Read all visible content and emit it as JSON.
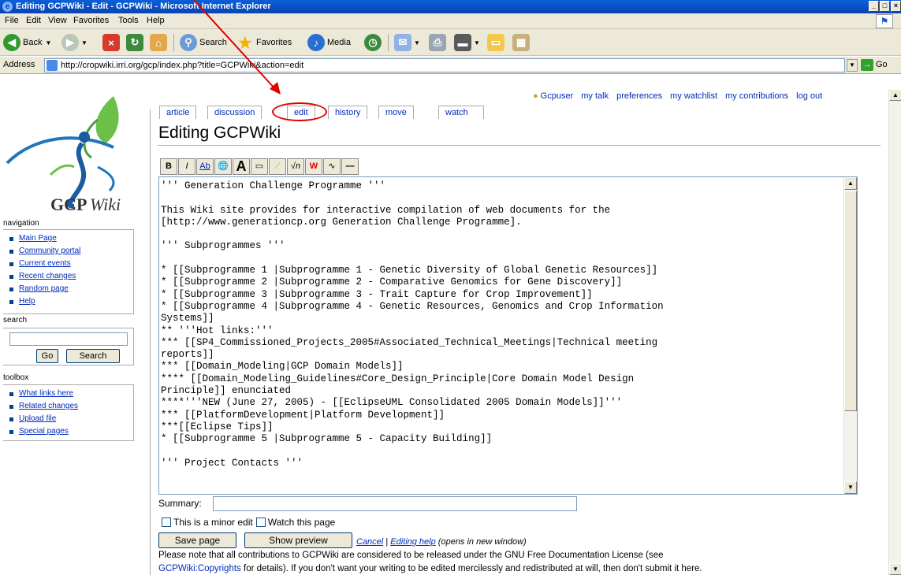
{
  "window": {
    "title": "Editing GCPWiki - Edit - GCPWiki - Microsoft Internet Explorer",
    "controls": [
      "_",
      "□",
      "×"
    ]
  },
  "menu": [
    "File",
    "Edit",
    "View",
    "Favorites",
    "Tools",
    "Help"
  ],
  "toolbar": {
    "back": "Back",
    "search": "Search",
    "favorites": "Favorites",
    "media": "Media"
  },
  "address": {
    "label": "Address",
    "url": "http://cropwiki.irri.org/gcp/index.php?title=GCPWiki&action=edit",
    "go": "Go"
  },
  "logo": {
    "text_bold": "GCP",
    "text_italic": "Wiki"
  },
  "sidebar": {
    "navigation_heading": "navigation",
    "navigation": [
      "Main Page",
      "Community portal",
      "Current events",
      "Recent changes",
      "Random page",
      "Help"
    ],
    "search_heading": "search",
    "search_value": "",
    "go_button": "Go",
    "search_button": "Search",
    "toolbox_heading": "toolbox",
    "toolbox": [
      "What links here",
      "Related changes",
      "Upload file",
      "Special pages"
    ]
  },
  "user_links": [
    "Gcpuser",
    "my talk",
    "preferences",
    "my watchlist",
    "my contributions",
    "log out"
  ],
  "tabs": [
    "article",
    "discussion",
    "edit",
    "history",
    "move",
    "watch"
  ],
  "heading": "Editing GCPWiki",
  "edit_toolbar": [
    "B",
    "I",
    "Ab",
    "🌐",
    "A",
    "▭",
    "⟋",
    "√n",
    "W",
    "∿",
    "—"
  ],
  "textarea_content": "''' Generation Challenge Programme '''\n\nThis Wiki site provides for interactive compilation of web documents for the\n[http://www.generationcp.org Generation Challenge Programme].\n\n''' Subprogrammes '''\n\n* [[Subprogramme 1 |Subprogramme 1 - Genetic Diversity of Global Genetic Resources]]\n* [[Subprogramme 2 |Subprogramme 2 - Comparative Genomics for Gene Discovery]]\n* [[Subprogramme 3 |Subprogramme 3 - Trait Capture for Crop Improvement]]\n* [[Subprogramme 4 |Subprogramme 4 - Genetic Resources, Genomics and Crop Information\nSystems]]\n** '''Hot links:'''\n*** [[SP4_Commissioned_Projects_2005#Associated_Technical_Meetings|Technical meeting\nreports]]\n*** [[Domain_Modeling|GCP Domain Models]]\n**** [[Domain_Modeling_Guidelines#Core_Design_Principle|Core Domain Model Design\nPrinciple]] enunciated\n****'''NEW (June 27, 2005) - [[EclipseUML Consolidated 2005 Domain Models]]'''\n*** [[PlatformDevelopment|Platform Development]]\n***[[Eclipse Tips]]\n* [[Subprogramme 5 |Subprogramme 5 - Capacity Building]]\n\n''' Project Contacts '''",
  "summary_label": "Summary:",
  "summary_value": "",
  "minor_edit_label": "This is a minor edit",
  "watch_label": "Watch this page",
  "save_button": "Save page",
  "preview_button": "Show preview",
  "cancel_link": "Cancel",
  "separator": "|",
  "editing_help_link": "Editing help",
  "editing_help_note": "(opens in new window)",
  "notice_line1": "Please note that all contributions to GCPWiki are considered to be released under the GNU Free Documentation License (see",
  "notice_copyright_link": "GCPWiki:Copyrights",
  "notice_line2_rest": "for details). If you don't want your writing to be edited mercilessly and redistributed at will, then don't submit it here.",
  "colors": {
    "link": "#002bb8",
    "title_bar": "#0a5fd8",
    "annotation": "#e00000"
  }
}
